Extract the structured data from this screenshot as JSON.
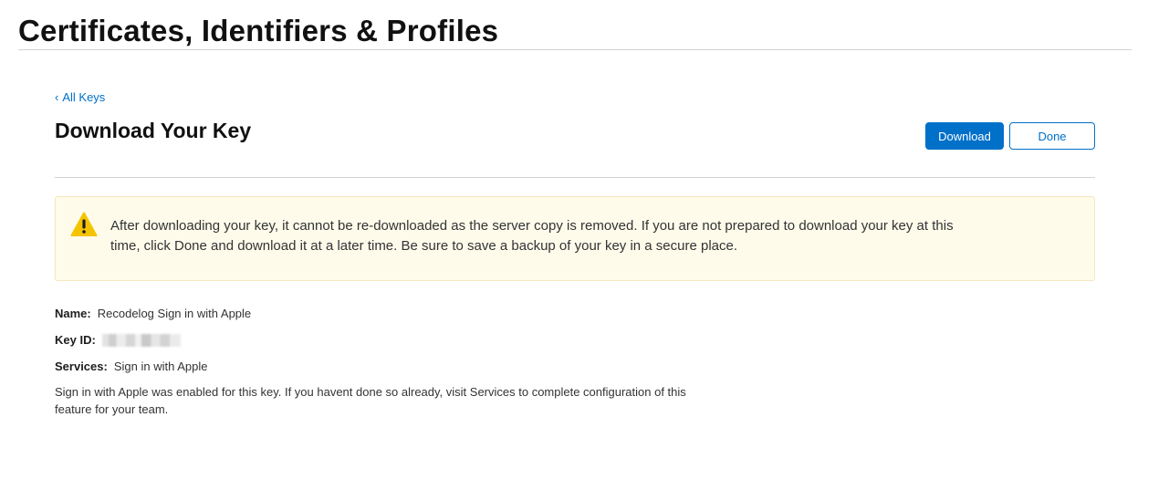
{
  "header": {
    "title": "Certificates, Identifiers & Profiles"
  },
  "nav": {
    "back_label": "All Keys"
  },
  "section": {
    "title": "Download Your Key",
    "download_label": "Download",
    "done_label": "Done"
  },
  "warning": {
    "text": "After downloading your key, it cannot be re-downloaded as the server copy is removed. If you are not prepared to download your key at this time, click Done and download it at a later time. Be sure to save a backup of your key in a secure place."
  },
  "details": {
    "name_label": "Name:",
    "name_value": "Recodelog Sign in with Apple",
    "keyid_label": "Key ID:",
    "services_label": "Services:",
    "services_value": "Sign in with Apple",
    "note": "Sign in with Apple was enabled for this key. If you havent done so already, visit Services to complete configuration of this feature for your team."
  },
  "colors": {
    "accent": "#0070c9",
    "warning_bg": "#fefbeb",
    "warning_icon": "#f5c400"
  }
}
